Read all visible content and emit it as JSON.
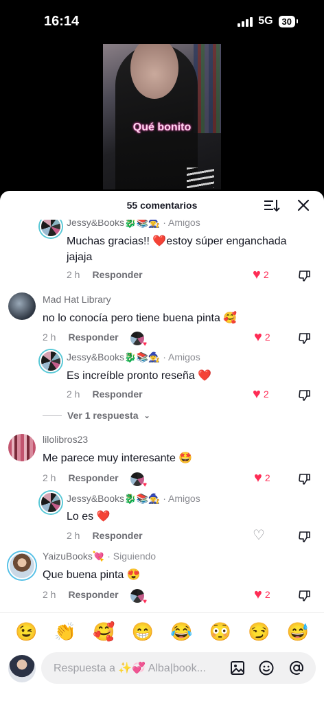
{
  "status": {
    "time": "16:14",
    "network": "5G",
    "battery": "30"
  },
  "video": {
    "caption": "Qué bonito"
  },
  "sheet": {
    "title": "55 comentarios"
  },
  "comments": [
    {
      "user": "Jessy&Books🐉📚🧙‍♀️",
      "tag": "· Amigos",
      "text": "Muchas gracias!! ❤️estoy súper enganchada jajaja",
      "time": "2 h",
      "reply": "Responder",
      "likes": "2"
    },
    {
      "user": "Mad Hat Library",
      "text": "no lo conocía pero tiene buena pinta 🥰",
      "time": "2 h",
      "reply": "Responder",
      "likes": "2"
    },
    {
      "user": "Jessy&Books🐉📚🧙‍♀️",
      "tag": "· Amigos",
      "text": "Es increíble pronto reseña ❤️",
      "time": "2 h",
      "reply": "Responder",
      "likes": "2"
    },
    {
      "view_more": "Ver 1 respuesta"
    },
    {
      "user": "lilolibros23",
      "text": "Me parece muy interesante 🤩",
      "time": "2 h",
      "reply": "Responder",
      "likes": "2"
    },
    {
      "user": "Jessy&Books🐉📚🧙‍♀️",
      "tag": "· Amigos",
      "text": "Lo es ❤️",
      "time": "2 h",
      "reply": "Responder",
      "likes": ""
    },
    {
      "user": "YaizuBooks💘",
      "tag": "· Siguiendo",
      "text": "Que buena pinta 😍",
      "time": "2 h",
      "reply": "Responder",
      "likes": "2"
    }
  ],
  "emojis": [
    "😉",
    "👏",
    "🥰",
    "😁",
    "😂",
    "😳",
    "😏",
    "😅"
  ],
  "input": {
    "placeholder": "Respuesta a ✨💞 Alba|book..."
  },
  "colors": {
    "like": "#fe2c55",
    "text": "#161823",
    "secondary": "#8a8b91"
  }
}
